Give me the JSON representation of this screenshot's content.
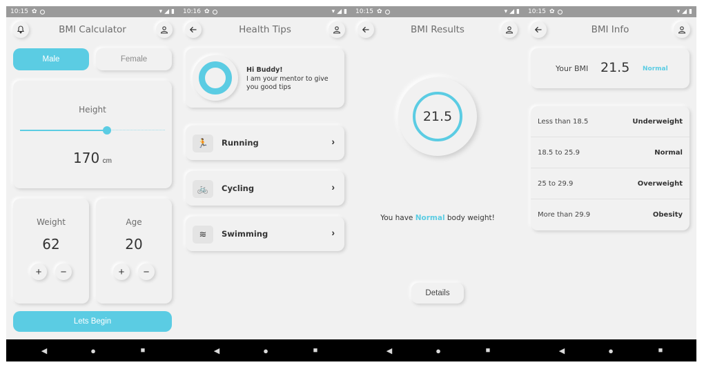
{
  "status": {
    "time": "10:15",
    "screen2_time": "10:16"
  },
  "accent": "#5bcce3",
  "screen1": {
    "title": "BMI Calculator",
    "gender": {
      "male": "Male",
      "female": "Female",
      "selected": "Male"
    },
    "height": {
      "label": "Height",
      "value": "170",
      "unit": "cm",
      "level": 0.6
    },
    "weight": {
      "label": "Weight",
      "value": "62"
    },
    "age": {
      "label": "Age",
      "value": "20"
    },
    "plus": "+",
    "minus": "−",
    "cta": "Lets Begin"
  },
  "screen2": {
    "title": "Health Tips",
    "mentor": {
      "greeting": "Hi Buddy!",
      "text": "I am your mentor to give you good tips"
    },
    "tips": [
      {
        "label": "Running",
        "icon": "running-icon"
      },
      {
        "label": "Cycling",
        "icon": "cycling-icon"
      },
      {
        "label": "Swimming",
        "icon": "swimming-icon"
      }
    ]
  },
  "screen3": {
    "title": "BMI Results",
    "bmi": "21.5",
    "message_prefix": "You have",
    "message_status": "Normal",
    "message_suffix": "body weight!",
    "details": "Details"
  },
  "screen4": {
    "title": "BMI Info",
    "your_bmi_label": "Your BMI",
    "your_bmi_value": "21.5",
    "your_bmi_status": "Normal",
    "ranges": [
      {
        "range": "Less than 18.5",
        "category": "Underweight"
      },
      {
        "range": "18.5 to 25.9",
        "category": "Normal"
      },
      {
        "range": "25 to 29.9",
        "category": "Overweight"
      },
      {
        "range": "More than 29.9",
        "category": "Obesity"
      }
    ]
  }
}
